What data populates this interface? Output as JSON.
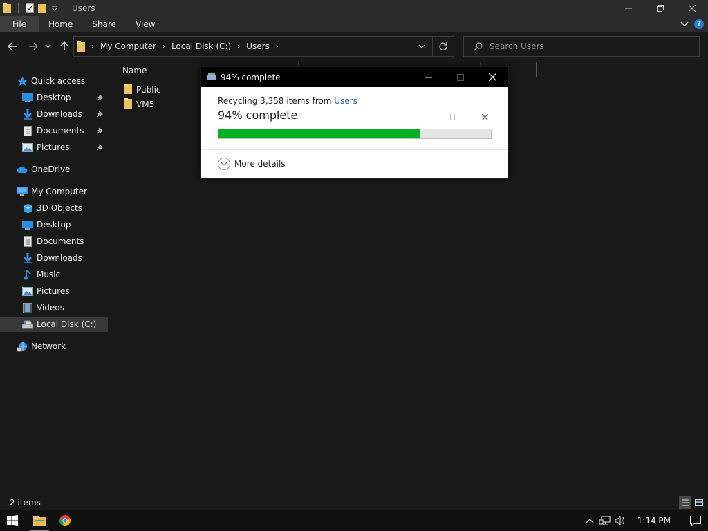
{
  "window": {
    "title": "Users"
  },
  "ribbon": {
    "tabs": [
      "File",
      "Home",
      "Share",
      "View"
    ]
  },
  "address": {
    "crumbs": [
      "My Computer",
      "Local Disk (C:)",
      "Users"
    ]
  },
  "search": {
    "placeholder": "Search Users"
  },
  "nav": {
    "quick_access": "Quick access",
    "quick_items": [
      "Desktop",
      "Downloads",
      "Documents",
      "Pictures"
    ],
    "onedrive": "OneDrive",
    "my_computer": "My Computer",
    "pc_items": [
      "3D Objects",
      "Desktop",
      "Documents",
      "Downloads",
      "Music",
      "Pictures",
      "Videos",
      "Local Disk (C:)"
    ],
    "network": "Network"
  },
  "content": {
    "column_name": "Name",
    "files": [
      "Public",
      "VM5"
    ]
  },
  "status": {
    "item_count": "2 items"
  },
  "taskbar": {
    "clock": "1:14 PM"
  },
  "dialog": {
    "title": "94% complete",
    "recycling_prefix": "Recycling 3,358 items from ",
    "recycling_link": "Users",
    "status": "94% complete",
    "progress_fraction": 0.74,
    "more_details": "More details"
  },
  "colors": {
    "progress_fill": "#06b025",
    "link": "#1a5fb4",
    "accent_blue": "#2a7ad4"
  }
}
